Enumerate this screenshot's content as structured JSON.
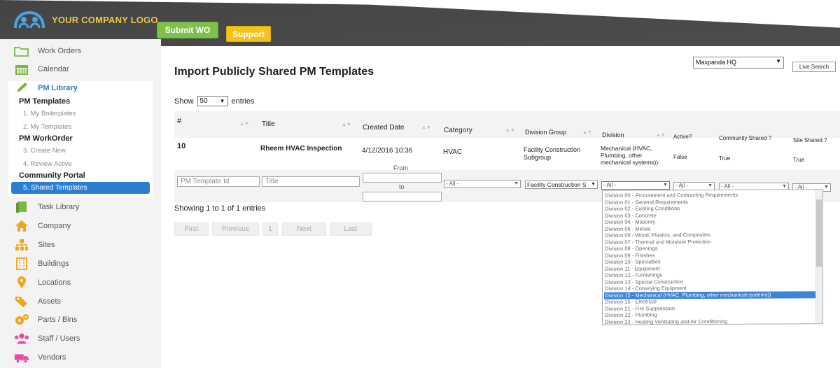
{
  "header": {
    "logo_text": "YOUR COMPANY LOGO",
    "submit_wo": "Submit WO",
    "support": "Support",
    "colors": {
      "topbar": "#4a4a4a",
      "submit": "#7ec04a",
      "support": "#f3c318",
      "accent": "#2a7fd3"
    }
  },
  "sidebar": {
    "items": [
      {
        "label": "Work Orders",
        "icon": "folder-icon"
      },
      {
        "label": "Calendar",
        "icon": "calendar-icon"
      },
      {
        "label": "PM Library",
        "icon": "pencil-icon"
      },
      {
        "label": "Task Library",
        "icon": "book-icon"
      },
      {
        "label": "Company",
        "icon": "home-icon"
      },
      {
        "label": "Sites",
        "icon": "sitemap-icon"
      },
      {
        "label": "Buildings",
        "icon": "building-icon"
      },
      {
        "label": "Locations",
        "icon": "map-pin-icon"
      },
      {
        "label": "Assets",
        "icon": "tags-icon"
      },
      {
        "label": "Parts / Bins",
        "icon": "gears-icon"
      },
      {
        "label": "Staff / Users",
        "icon": "users-icon"
      },
      {
        "label": "Vendors",
        "icon": "truck-icon"
      }
    ],
    "pm_templates": "PM Templates",
    "my_boilerplates": "1. My Boilerplates",
    "my_templates": "2. My Templates",
    "pm_workorder": "PM WorkOrder",
    "create_new": "3. Create New",
    "review_active": "4. Review Active",
    "community_portal": "Community Portal",
    "shared_templates": "5. Shared Templates"
  },
  "topright": {
    "site_select": "Maxpanda HQ",
    "live_search": "Live Search"
  },
  "main": {
    "title": "Import Publicly Shared PM Templates",
    "show_label": "Show",
    "show_value": "50",
    "entries_label": "entries",
    "columns": [
      "#",
      "Title",
      "Created Date",
      "Category",
      "Division Group",
      "Division",
      "Active?",
      "Community Shared ?",
      "Site Shared ?"
    ],
    "row": {
      "num": "10",
      "title": "Rheem HVAC Inspection",
      "created": "4/12/2016 10:36",
      "category": "HVAC",
      "division_group": "Facility Construction Subgroup",
      "division": "Mechanical (HVAC, Plumbing, other mechanical systems))",
      "active": "False",
      "community_shared": "True",
      "site_shared": "True"
    },
    "filters": {
      "pm_template_id": "PM Template Id",
      "title": "Title",
      "from": "From",
      "to": "to",
      "category": "- All -",
      "division_group": "Facility Construction S",
      "division": "- All -",
      "active": "- All -",
      "community": "- All -",
      "site": "- All -"
    },
    "showing": "Showing 1 to 1 of 1 entries",
    "pager": {
      "first": "First",
      "previous": "Previous",
      "page": "1",
      "next": "Next",
      "last": "Last"
    }
  },
  "division_dropdown": [
    "Division 00 - Procurement and Contracting Requirements",
    "Division 01 - General Requirements",
    "Division 02 - Existing Conditions",
    "Division 03 - Concrete",
    "Division 04 - Masonry",
    "Division 05 - Metals",
    "Division 06 - Wood, Plastics, and Composites",
    "Division 07 - Thermal and Moisture Protection",
    "Division 08 - Openings",
    "Division 09 - Finishes",
    "Division 10 - Specialties",
    "Division 11 - Equipment",
    "Division 12 - Furnishings",
    "Division 13 - Special Construction",
    "Division 14 - Conveying Equipment",
    "Division 15 - Mechanical (HVAC, Plumbing, other mechanical systems))",
    "Division 16 - Electrical",
    "Division 21 - Fire Suppression",
    "Division 22 - Plumbing",
    "Division 23 - Heating Ventilating and Air Conditioning"
  ],
  "division_dropdown_selected": "Division 15 - Mechanical (HVAC, Plumbing, other mechanical systems))"
}
